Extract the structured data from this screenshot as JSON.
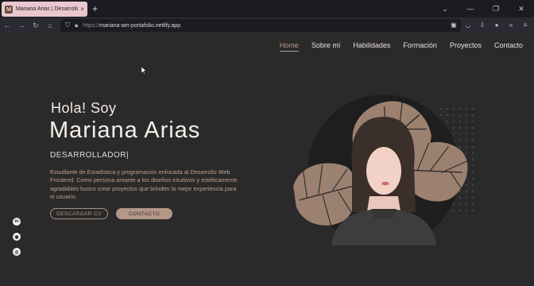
{
  "browser": {
    "tab_title": "Mariana Arias | Desarrollador",
    "tab_close": "×",
    "new_tab": "+",
    "url_protocol": "https://",
    "url_host": "mariana-am-portafolio.netlify.app",
    "icons": [
      "back-icon",
      "forward-icon",
      "reload-icon",
      "home-icon",
      "shield-icon",
      "lock-icon",
      "star-icon"
    ]
  },
  "nav": {
    "items": [
      "Home",
      "Sobre mí",
      "Habilidades",
      "Formación",
      "Proyectos",
      "Contacto"
    ],
    "active_index": 0
  },
  "hero": {
    "greeting": "Hola! Soy",
    "name": "Mariana Arias",
    "role": "DESARROLLADOR",
    "description": "Estudiante de Estadística y programación enfocada al Desarrollo Web Frontend. Como persona amante a los diseños intuitivos y estéticamente agradables busco crear proyectos que brinden la mejor experiencia para el usuario.",
    "cv_button": "DESCARGAR CV",
    "contact_button": "CONTACTO"
  },
  "social": [
    "linkedin-icon",
    "github-icon",
    "instagram-icon"
  ],
  "colors": {
    "accent": "#b49787",
    "page_bg": "#2b2a2a",
    "leaf": "#9c8171"
  }
}
